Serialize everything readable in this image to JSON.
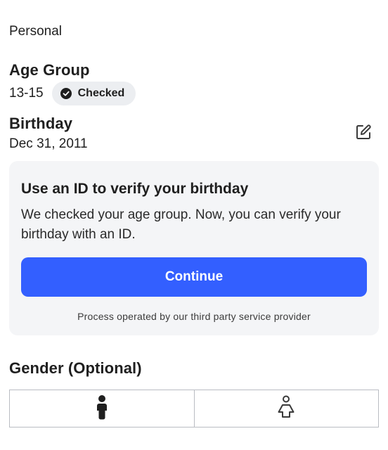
{
  "section": {
    "label": "Personal"
  },
  "age_group": {
    "heading": "Age Group",
    "value": "13-15",
    "badge": {
      "label": "Checked",
      "icon": "check-circle-icon"
    }
  },
  "birthday": {
    "heading": "Birthday",
    "value": "Dec 31, 2011",
    "edit_icon": "edit-icon"
  },
  "verify_card": {
    "title": "Use an ID to verify your birthday",
    "body": "We checked your age group. Now, you can verify your birthday with an ID.",
    "button_label": "Continue",
    "footnote": "Process operated by our third party service provider"
  },
  "gender": {
    "heading": "Gender (Optional)",
    "options": [
      {
        "icon": "male-person-icon"
      },
      {
        "icon": "female-person-icon"
      }
    ]
  },
  "colors": {
    "accent": "#335fff",
    "card_background": "#f4f5f7",
    "badge_background": "#eceef1",
    "text": "#1f1f1f",
    "border": "#b9bcc2"
  }
}
